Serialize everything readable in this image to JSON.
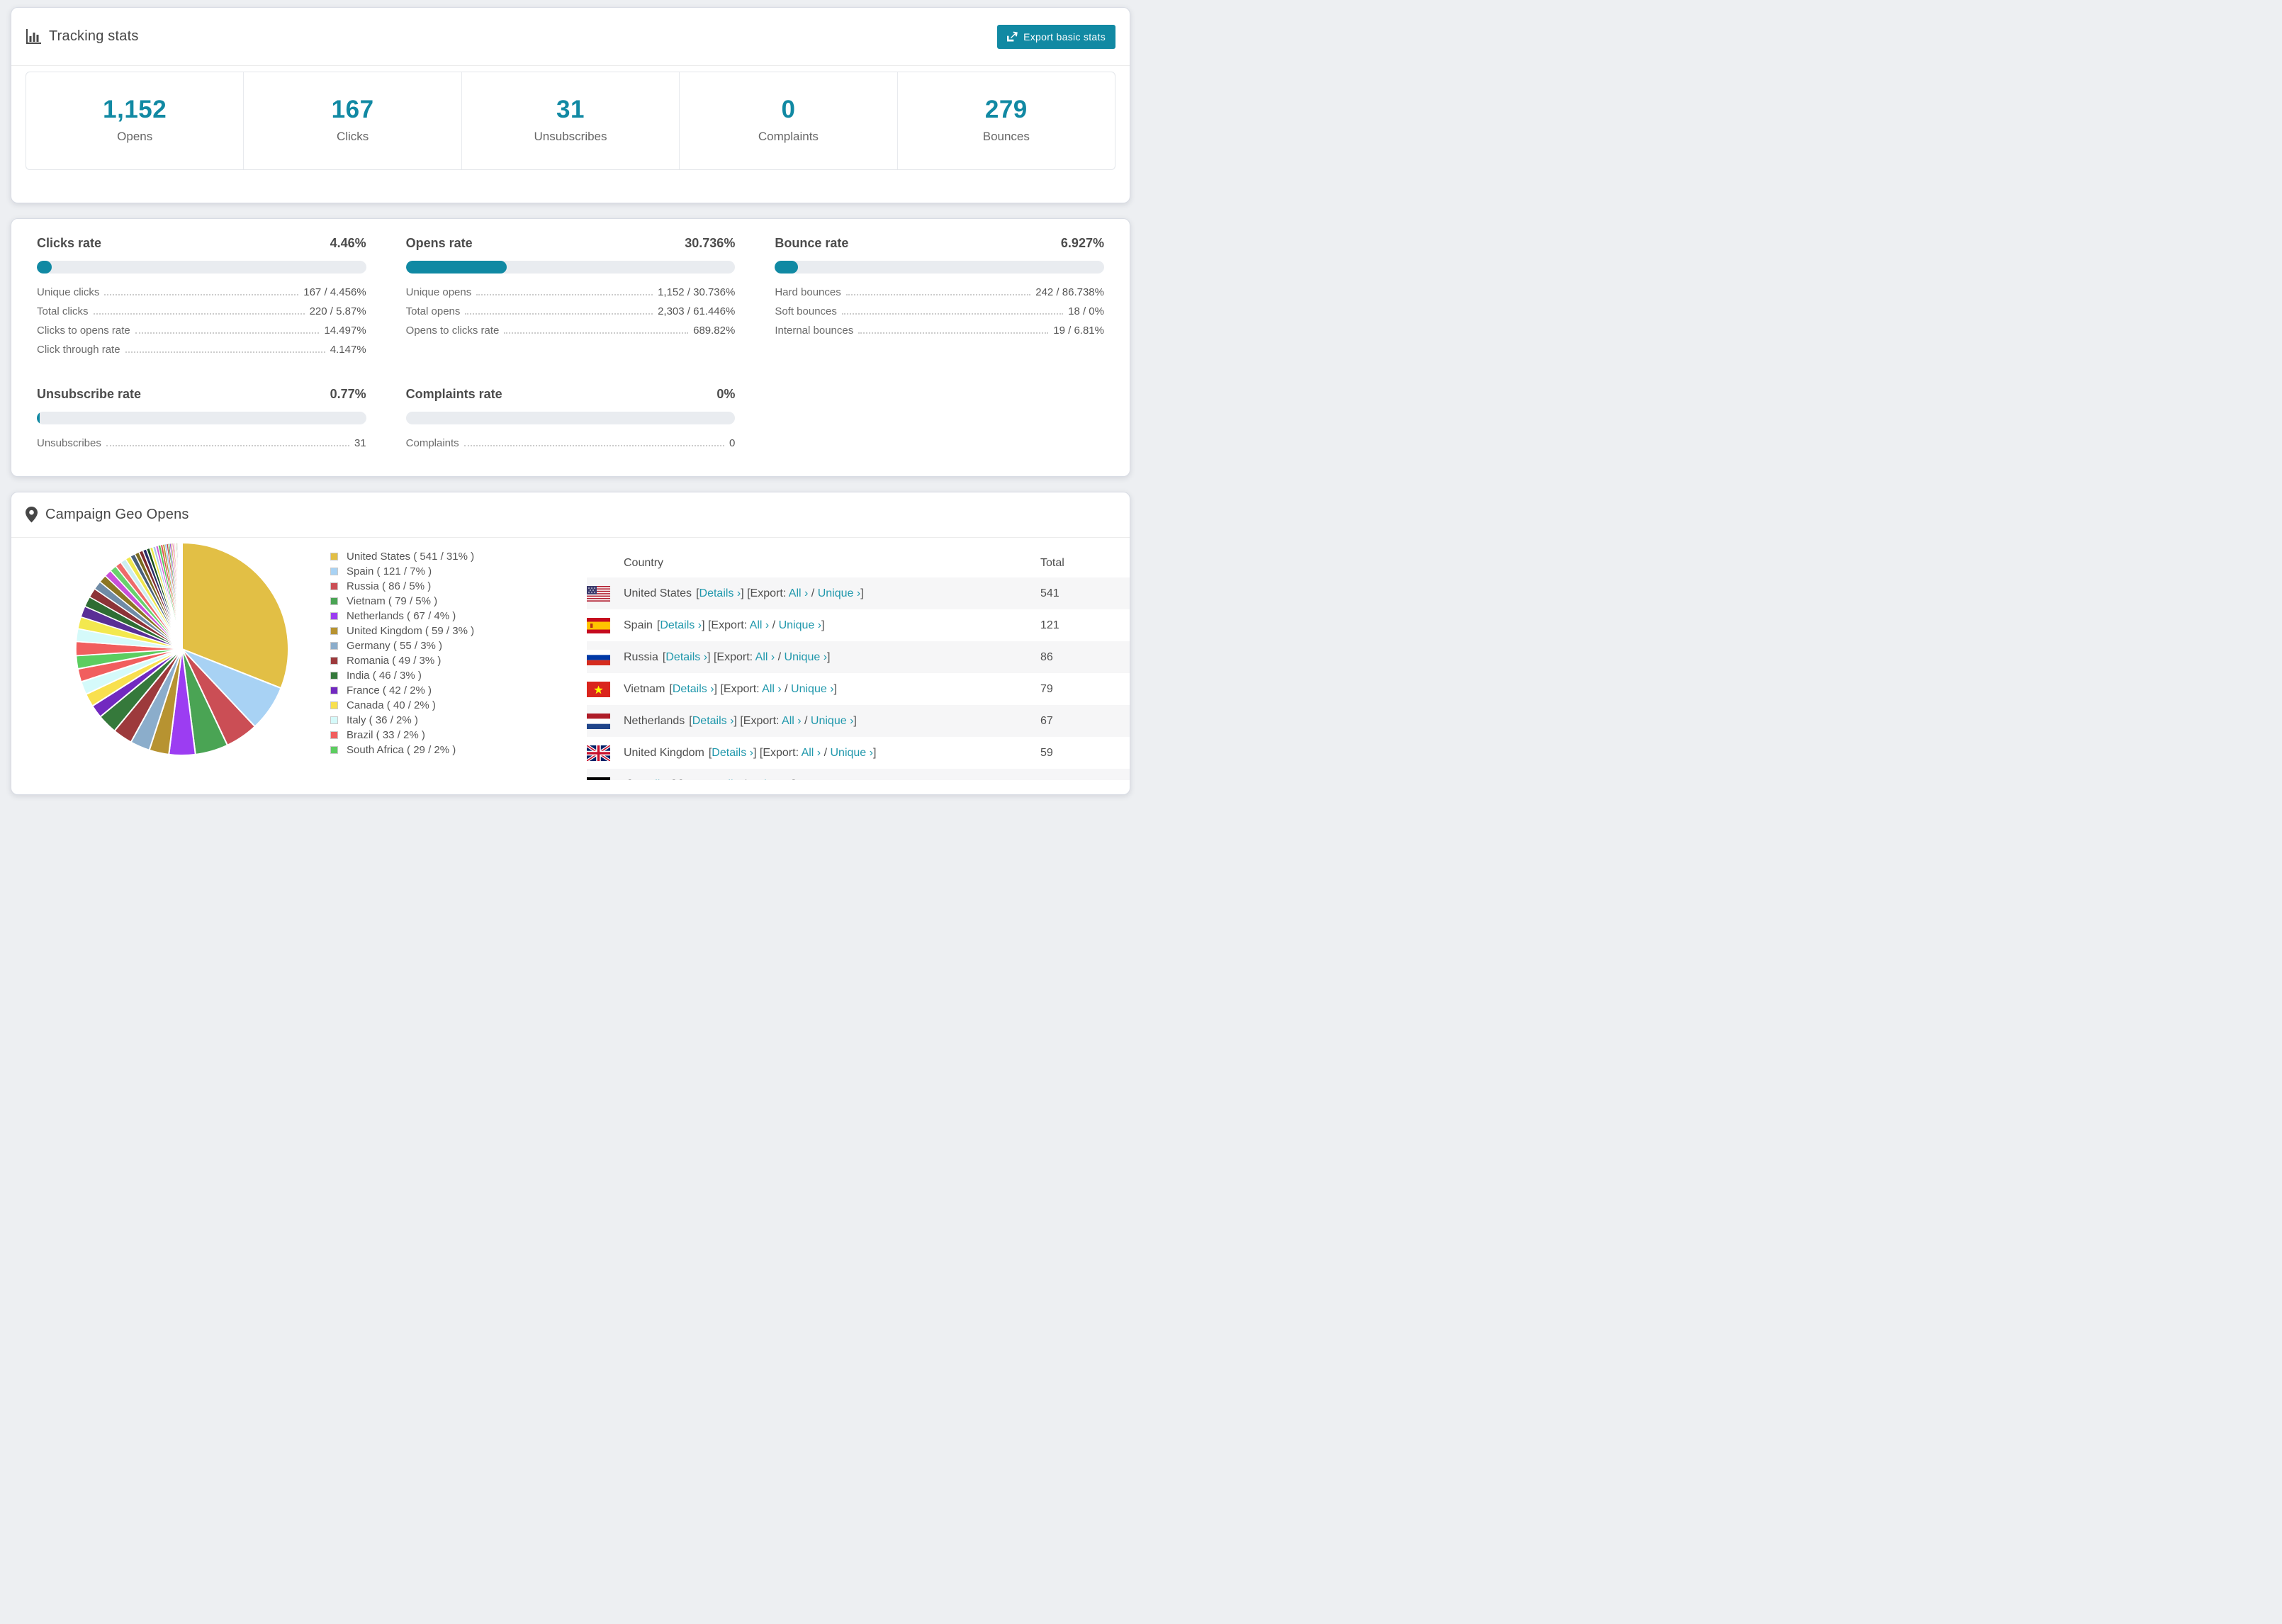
{
  "header": {
    "title": "Tracking stats",
    "export_button": "Export basic stats"
  },
  "stats": [
    {
      "value": "1,152",
      "label": "Opens"
    },
    {
      "value": "167",
      "label": "Clicks"
    },
    {
      "value": "31",
      "label": "Unsubscribes"
    },
    {
      "value": "0",
      "label": "Complaints"
    },
    {
      "value": "279",
      "label": "Bounces"
    }
  ],
  "rates": {
    "clicks": {
      "title": "Clicks rate",
      "percent": "4.46%",
      "bar": 4.46,
      "rows": [
        {
          "label": "Unique clicks",
          "value": "167 / 4.456%"
        },
        {
          "label": "Total clicks",
          "value": "220 / 5.87%"
        },
        {
          "label": "Clicks to opens rate",
          "value": "14.497%"
        },
        {
          "label": "Click through rate",
          "value": "4.147%"
        }
      ]
    },
    "opens": {
      "title": "Opens rate",
      "percent": "30.736%",
      "bar": 30.736,
      "rows": [
        {
          "label": "Unique opens",
          "value": "1,152 / 30.736%"
        },
        {
          "label": "Total opens",
          "value": "2,303 / 61.446%"
        },
        {
          "label": "Opens to clicks rate",
          "value": "689.82%"
        }
      ]
    },
    "bounce": {
      "title": "Bounce rate",
      "percent": "6.927%",
      "bar": 6.927,
      "rows": [
        {
          "label": "Hard bounces",
          "value": "242 / 86.738%"
        },
        {
          "label": "Soft bounces",
          "value": "18 / 0%"
        },
        {
          "label": "Internal bounces",
          "value": "19 / 6.81%"
        }
      ]
    },
    "unsubscribe": {
      "title": "Unsubscribe rate",
      "percent": "0.77%",
      "bar": 0.77,
      "rows": [
        {
          "label": "Unsubscribes",
          "value": "31"
        }
      ]
    },
    "complaints": {
      "title": "Complaints rate",
      "percent": "0%",
      "bar": 0,
      "rows": [
        {
          "label": "Complaints",
          "value": "0"
        }
      ]
    }
  },
  "geo": {
    "title": "Campaign Geo Opens",
    "chart_data": {
      "type": "pie",
      "title": "Campaign Geo Opens",
      "legend_position": "right",
      "slices": [
        {
          "name": "United States",
          "count": 541,
          "pct": 31,
          "color": "#e2bf45",
          "flag": "us"
        },
        {
          "name": "Spain",
          "count": 121,
          "pct": 7,
          "color": "#a8d2f4",
          "flag": "es"
        },
        {
          "name": "Russia",
          "count": 86,
          "pct": 5,
          "color": "#cb4e55",
          "flag": "ru"
        },
        {
          "name": "Vietnam",
          "count": 79,
          "pct": 5,
          "color": "#4aa454",
          "flag": "vn"
        },
        {
          "name": "Netherlands",
          "count": 67,
          "pct": 4,
          "color": "#9c3df2",
          "flag": "nl"
        },
        {
          "name": "United Kingdom",
          "count": 59,
          "pct": 3,
          "color": "#b79331",
          "flag": "gb"
        },
        {
          "name": "Germany",
          "count": 55,
          "pct": 3,
          "color": "#8badcb",
          "flag": "de"
        },
        {
          "name": "Romania",
          "count": 49,
          "pct": 3,
          "color": "#9d3a3c",
          "flag": "ro"
        },
        {
          "name": "India",
          "count": 46,
          "pct": 3,
          "color": "#35793b",
          "flag": "in"
        },
        {
          "name": "France",
          "count": 42,
          "pct": 2,
          "color": "#7229c0",
          "flag": "fr"
        },
        {
          "name": "Canada",
          "count": 40,
          "pct": 2,
          "color": "#f8e04e",
          "flag": "ca"
        },
        {
          "name": "Italy",
          "count": 36,
          "pct": 2,
          "color": "#d5fafa",
          "flag": "it"
        },
        {
          "name": "Brazil",
          "count": 33,
          "pct": 2,
          "color": "#f15e5e",
          "flag": "br"
        },
        {
          "name": "South Africa",
          "count": 29,
          "pct": 2,
          "color": "#5ccd60",
          "flag": "za"
        }
      ],
      "others_total_pct": 26,
      "others_weights": [
        1.7,
        1.55,
        1.45,
        1.35,
        1.25,
        1.15,
        1.05,
        0.95,
        0.88,
        0.82,
        0.76,
        0.7,
        0.65,
        0.6,
        0.55,
        0.5,
        0.46,
        0.42,
        0.38,
        0.35,
        0.32,
        0.29,
        0.26,
        0.24,
        0.22,
        0.2,
        0.18,
        0.16,
        0.15,
        0.14,
        0.13,
        0.12,
        0.11,
        0.1,
        0.09,
        0.08,
        0.07,
        0.065,
        0.06,
        0.055,
        0.05,
        0.045,
        0.04,
        0.035
      ],
      "others_colors": [
        "#f15e5e",
        "#d5fafa",
        "#f3e84e",
        "#5a2f96",
        "#2f6d33",
        "#8c3337",
        "#6f8ba6",
        "#8c7623",
        "#c94fd9",
        "#68d16c",
        "#ee6a6a",
        "#cdeef0",
        "#efe74f",
        "#49607a",
        "#7b6b20",
        "#7e2b2f",
        "#2b2b68",
        "#184f20",
        "#e8e84e",
        "#a8c8ea",
        "#d55bd9",
        "#55c75b",
        "#df5252",
        "#b7952f",
        "#99c5ef",
        "#cb4444",
        "#3f9e48",
        "#8a40d2",
        "#c2a033",
        "#e060a8"
      ]
    },
    "legend_format": {
      "open": "( ",
      "sep": " / ",
      "close": "% )"
    },
    "table": {
      "columns": [
        "Country",
        "Total"
      ],
      "links": {
        "details": "Details ›",
        "export_prefix": "Export:",
        "all": "All ›",
        "unique": "Unique ›"
      },
      "rows": [
        {
          "country": "United States",
          "total": "541",
          "flag": "us"
        },
        {
          "country": "Spain",
          "total": "121",
          "flag": "es"
        },
        {
          "country": "Russia",
          "total": "86",
          "flag": "ru"
        },
        {
          "country": "Vietnam",
          "total": "79",
          "flag": "vn"
        },
        {
          "country": "Netherlands",
          "total": "67",
          "flag": "nl"
        },
        {
          "country": "United Kingdom",
          "total": "59",
          "flag": "gb"
        }
      ],
      "partial_row": {
        "country": "Germany",
        "flag": "de"
      }
    }
  },
  "colors": {
    "accent_teal": "#1189a3",
    "link_teal": "#2098ac",
    "bar_track": "#e9ecf0",
    "page_bg": "#edeff2",
    "stripe": "#f6f6f7"
  }
}
